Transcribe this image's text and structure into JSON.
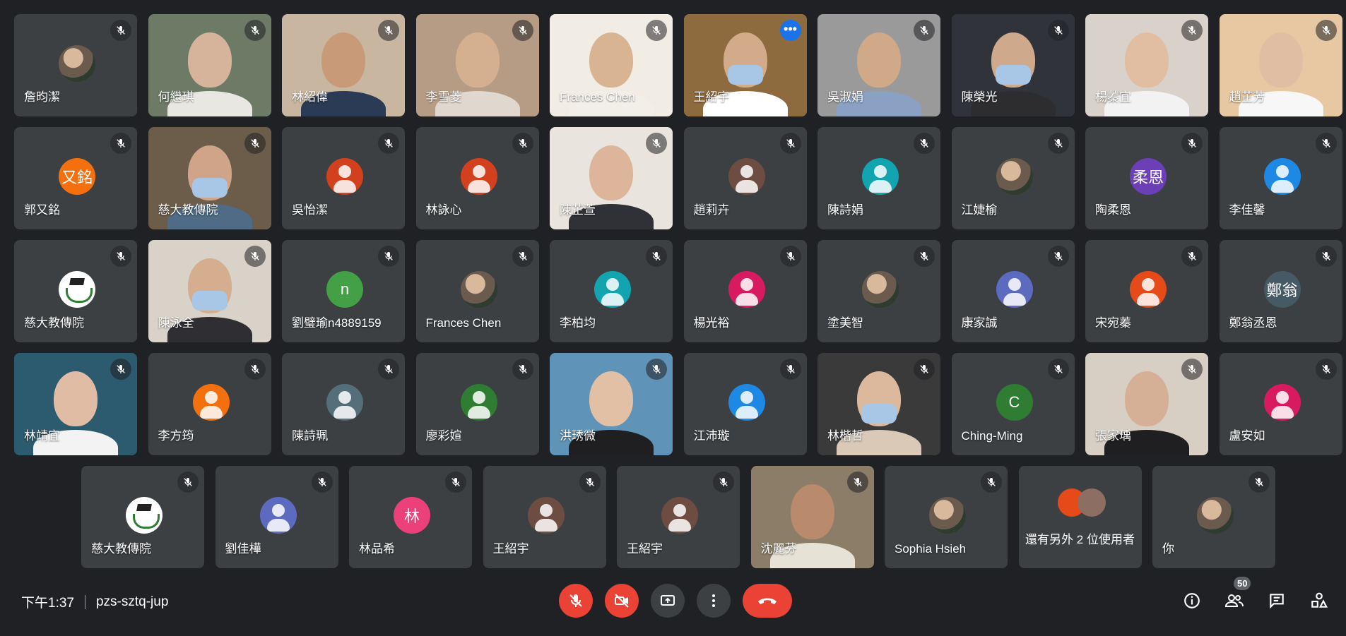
{
  "participants_grid": [
    {
      "name": "詹昀潔",
      "kind": "avatar-photo"
    },
    {
      "name": "何繼琪",
      "kind": "video",
      "bg": "#6c7a66",
      "skin": "#d6b49c",
      "shirt": "#e9e7e2"
    },
    {
      "name": "林紹偉",
      "kind": "video",
      "bg": "#c9b6a0",
      "skin": "#c99a78",
      "shirt": "#2b3a55"
    },
    {
      "name": "李雪菱",
      "kind": "video",
      "bg": "#b79c85",
      "skin": "#d5b090",
      "shirt": "#e0d8cf"
    },
    {
      "name": "Frances Chen",
      "kind": "video",
      "bg": "#f1ece4",
      "skin": "#d9b493",
      "shirt": "#f2efe9"
    },
    {
      "name": "王紹宇",
      "kind": "video",
      "bg": "#8e6a3f",
      "skin": "#d2ab8a",
      "shirt": "#ffffff",
      "mask": true,
      "active": true
    },
    {
      "name": "吳淑娟",
      "kind": "video",
      "bg": "#9a9a9a",
      "skin": "#cfa988",
      "shirt": "#8aa1c4"
    },
    {
      "name": "陳榮光",
      "kind": "video",
      "bg": "#30343a",
      "skin": "#cfa98c",
      "shirt": "#2d2d30",
      "mask": true
    },
    {
      "name": "楊蓁宜",
      "kind": "video",
      "bg": "#d9d2ca",
      "skin": "#e1bda2",
      "shirt": "#f2f2f2"
    },
    {
      "name": "趙芷芳",
      "kind": "video",
      "bg": "#e7c8a2",
      "skin": "#e0bea3",
      "shirt": "#f7f7f7"
    },
    {
      "name": "郭又銘",
      "kind": "avatar",
      "initial": "又銘",
      "color": "#f4700f"
    },
    {
      "name": "慈大教傳院",
      "kind": "video",
      "bg": "#6b5d4a",
      "skin": "#cfa489",
      "shirt": "#4f6b86",
      "mask": true
    },
    {
      "name": "吳怡潔",
      "kind": "avatar-generic",
      "color": "#d2401e"
    },
    {
      "name": "林詠心",
      "kind": "avatar-generic",
      "color": "#d2401e"
    },
    {
      "name": "陳芷萱",
      "kind": "video",
      "bg": "#e9e4de",
      "skin": "#dcb59a",
      "shirt": "#2f3136"
    },
    {
      "name": "趙莉卉",
      "kind": "avatar-generic",
      "color": "#6d4c41"
    },
    {
      "name": "陳詩娟",
      "kind": "avatar-generic",
      "color": "#12a4af"
    },
    {
      "name": "江婕榆",
      "kind": "avatar-photo"
    },
    {
      "name": "陶柔恩",
      "kind": "avatar",
      "initial": "柔恩",
      "color": "#6b3fb5"
    },
    {
      "name": "李佳馨",
      "kind": "avatar-generic",
      "color": "#1e88e5"
    },
    {
      "name": "慈大教傳院",
      "kind": "avatar-emblem"
    },
    {
      "name": "陳泳全",
      "kind": "video",
      "bg": "#d8d2c8",
      "skin": "#d4ae8f",
      "shirt": "#2f2f33",
      "mask": true
    },
    {
      "name": "劉璧瑜n4889159",
      "kind": "avatar",
      "initial": "n",
      "color": "#43a047"
    },
    {
      "name": "Frances Chen",
      "kind": "avatar-photo"
    },
    {
      "name": "李柏均",
      "kind": "avatar-generic",
      "color": "#12a4af"
    },
    {
      "name": "楊光裕",
      "kind": "avatar-generic",
      "color": "#d81b60"
    },
    {
      "name": "塗美智",
      "kind": "avatar-photo"
    },
    {
      "name": "康家誠",
      "kind": "avatar-generic",
      "color": "#5c6bc0"
    },
    {
      "name": "宋宛蓁",
      "kind": "avatar-generic",
      "color": "#e64a19"
    },
    {
      "name": "鄭翁丞恩",
      "kind": "avatar",
      "initial": "鄭翁",
      "color": "#455a64"
    },
    {
      "name": "林靖宜",
      "kind": "video",
      "bg": "#2c5a6e",
      "skin": "#e0bca4",
      "shirt": "#f3f3f3"
    },
    {
      "name": "李方筠",
      "kind": "avatar-generic",
      "color": "#f4700f"
    },
    {
      "name": "陳詩珮",
      "kind": "avatar-generic",
      "color": "#546e7a"
    },
    {
      "name": "廖彩媗",
      "kind": "avatar-generic",
      "color": "#2e7d32"
    },
    {
      "name": "洪琇微",
      "kind": "video",
      "bg": "#5f93b7",
      "skin": "#e2c0a6",
      "shirt": "#1f1f22"
    },
    {
      "name": "江沛璇",
      "kind": "avatar-generic",
      "color": "#1e88e5"
    },
    {
      "name": "林楷哲",
      "kind": "video",
      "bg": "#3a3a3a",
      "skin": "#dcb99c",
      "shirt": "#d9c9b6",
      "mask": true
    },
    {
      "name": "Ching-Ming",
      "kind": "avatar",
      "initial": "C",
      "color": "#2e7d32"
    },
    {
      "name": "張家瑀",
      "kind": "video",
      "bg": "#d7cfc3",
      "skin": "#d6b096",
      "shirt": "#1f1f22"
    },
    {
      "name": "盧安如",
      "kind": "avatar-generic",
      "color": "#d81b60"
    }
  ],
  "participants_last_row": [
    {
      "name": "慈大教傳院",
      "kind": "avatar-emblem"
    },
    {
      "name": "劉佳樺",
      "kind": "avatar-generic",
      "color": "#5c6bc0"
    },
    {
      "name": "林品希",
      "kind": "avatar",
      "initial": "林",
      "color": "#ec407a"
    },
    {
      "name": "王紹宇",
      "kind": "avatar-generic",
      "color": "#6d4c41"
    },
    {
      "name": "王紹宇",
      "kind": "avatar-generic",
      "color": "#6d4c41"
    },
    {
      "name": "沈麗芬",
      "kind": "video",
      "bg": "#8b7d68",
      "skin": "#b98a6b",
      "shirt": "#e7e2d6"
    },
    {
      "name": "Sophia Hsieh",
      "kind": "avatar-photo"
    },
    {
      "name": "還有另外 2 位使用者",
      "kind": "others"
    },
    {
      "name": "你",
      "kind": "avatar-photo"
    }
  ],
  "bottom_bar": {
    "time": "下午1:37",
    "meeting_code": "pzs-sztq-jup",
    "participant_count": "50"
  },
  "colors": {
    "background": "#202124",
    "tile": "#3c4043",
    "danger": "#ea4335",
    "accent": "#1a73e8"
  }
}
